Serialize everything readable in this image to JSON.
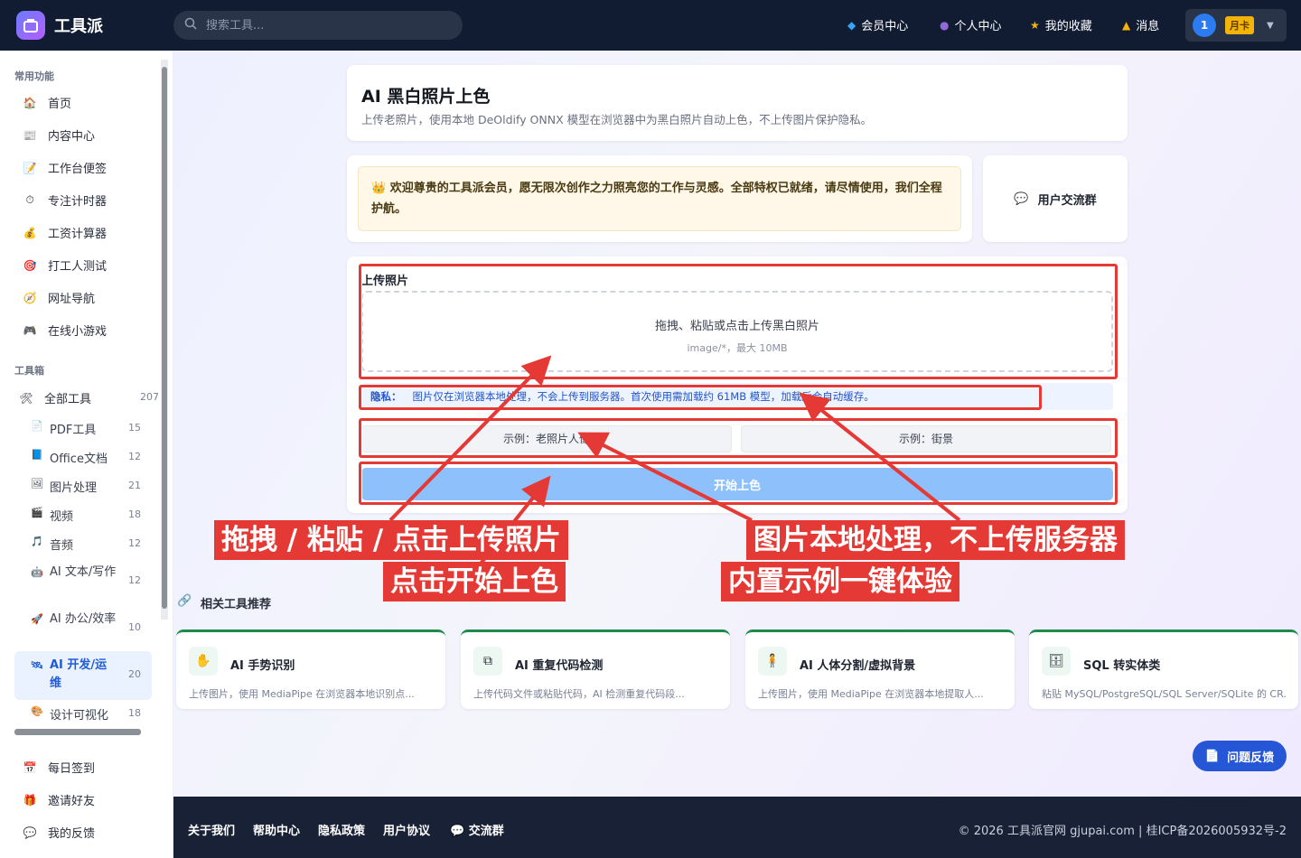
{
  "topbar": {
    "app_name": "工具派",
    "search_placeholder": "搜索工具...",
    "nav": [
      {
        "label": "会员中心",
        "icon": "diamond-icon"
      },
      {
        "label": "个人中心",
        "icon": "user-icon"
      },
      {
        "label": "我的收藏",
        "icon": "star-icon"
      },
      {
        "label": "消息",
        "icon": "bell-icon"
      }
    ],
    "user_level": "1",
    "plan_badge": "月卡"
  },
  "sidebar": {
    "common_title": "常用功能",
    "common_items": [
      "首页",
      "内容中心",
      "工作台便签",
      "专注计时器",
      "工资计算器",
      "打工人测试",
      "网址导航",
      "在线小游戏"
    ],
    "toolbox_title": "工具箱",
    "all_tools": {
      "label": "全部工具",
      "count": "207"
    },
    "categories": [
      {
        "label": "PDF工具",
        "count": "15"
      },
      {
        "label": "Office文档",
        "count": "12"
      },
      {
        "label": "图片处理",
        "count": "21"
      },
      {
        "label": "视频",
        "count": "18"
      },
      {
        "label": "音频",
        "count": "12"
      },
      {
        "label": "AI 文本/写作",
        "count": "12"
      },
      {
        "label": "AI 办公/效率",
        "count": "10"
      },
      {
        "label": "AI 开发/运维",
        "count": "20"
      },
      {
        "label": "设计可视化",
        "count": "18"
      }
    ],
    "bottom_items": [
      "每日签到",
      "邀请好友",
      "我的反馈"
    ]
  },
  "header_card": {
    "title": "AI 黑白照片上色",
    "description": "上传老照片，使用本地 DeOldify ONNX 模型在浏览器中为黑白照片自动上色，不上传图片保护隐私。"
  },
  "welcome": "欢迎尊贵的工具派会员，愿无限次创作之力照亮您的工作与灵感。全部特权已就绪，请尽情使用，我们全程护航。",
  "community": "用户交流群",
  "upload": {
    "title": "上传照片",
    "drop_text": "拖拽、粘贴或点击上传黑白照片",
    "drop_hint": "image/*，最大 10MB",
    "privacy_label": "隐私：",
    "privacy_text": "图片仅在浏览器本地处理，不会上传到服务器。首次使用需加载约 61MB 模型，加载后会自动缓存。",
    "sample1": "示例：老照片人像",
    "sample2": "示例：街景",
    "start": "开始上色"
  },
  "callouts": {
    "c1": "拖拽 / 粘贴 / 点击上传照片",
    "c2": "点击开始上色",
    "c3": "图片本地处理，不上传服务器",
    "c4": "内置示例一键体验"
  },
  "related": {
    "title": "相关工具推荐",
    "tools": [
      {
        "name": "AI 手势识别",
        "desc": "上传图片，使用 MediaPipe 在浏览器本地识别点..."
      },
      {
        "name": "AI 重复代码检测",
        "desc": "上传代码文件或粘贴代码，AI 检测重复代码段..."
      },
      {
        "name": "AI 人体分割/虚拟背景",
        "desc": "上传图片，使用 MediaPipe 在浏览器本地提取人..."
      },
      {
        "name": "SQL 转实体类",
        "desc": "粘贴 MySQL/PostgreSQL/SQL Server/SQLite 的 CR..."
      }
    ]
  },
  "feedback": "问题反馈",
  "footer": {
    "links": [
      "关于我们",
      "帮助中心",
      "隐私政策",
      "用户协议",
      "交流群"
    ],
    "copyright": "© 2026 工具派官网 gjupai.com | 桂ICP备2026005932号-2"
  },
  "colors": {
    "accent": "#2456d6",
    "annotation": "#e53935",
    "topbar": "#111c33"
  }
}
